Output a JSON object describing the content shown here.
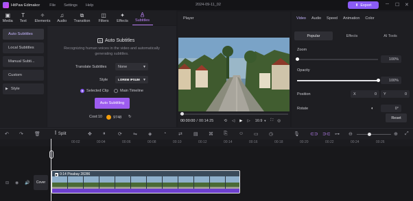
{
  "app": {
    "name": "HitPaw Edimakor",
    "menu": [
      "File",
      "Settings",
      "Help"
    ],
    "date": "2024-09-11_02",
    "export_label": "Export"
  },
  "toolbar": [
    {
      "label": "Media",
      "icon": "media-icon"
    },
    {
      "label": "Text",
      "icon": "text-icon"
    },
    {
      "label": "Elements",
      "icon": "elements-icon"
    },
    {
      "label": "Audio",
      "icon": "audio-icon"
    },
    {
      "label": "Transition",
      "icon": "transition-icon"
    },
    {
      "label": "Filters",
      "icon": "filters-icon"
    },
    {
      "label": "Effects",
      "icon": "effects-icon"
    },
    {
      "label": "Subtitles",
      "icon": "subtitles-icon",
      "active": true
    }
  ],
  "leftnav": [
    "Auto Subtitles",
    "Local Subtitles",
    "Manual Subti...",
    "Custom",
    "Style"
  ],
  "panel": {
    "title": "Auto Subtitles",
    "description": "Recognizing human voices in the video and automatically generating subtitles.",
    "translate_label": "Translate Subtitles",
    "translate_value": "None",
    "style_label": "Style",
    "style_value": "LOREM IPSUM",
    "radio_selected": "Selected Clip",
    "radio_main": "Main Timeline",
    "button": "Auto Subtitling",
    "cost_label": "Cost:10",
    "balance": "9748"
  },
  "player": {
    "title": "Player",
    "current": "00:00:00",
    "total": "00:14:25",
    "ratio": "16:9",
    "progress": 0.0
  },
  "right": {
    "tabs": [
      "Video",
      "Audio",
      "Speed",
      "Animation",
      "Color"
    ],
    "subtabs": [
      "Popular",
      "Effects",
      "AI Tools"
    ],
    "zoom_label": "Zoom",
    "zoom_value": "100%",
    "zoom_level": 0.0,
    "opacity_label": "Opacity",
    "opacity_value": "100%",
    "opacity_level": 1.0,
    "position_label": "Position",
    "pos_x_label": "X",
    "pos_x": "0",
    "pos_y_label": "Y",
    "pos_y": "0",
    "rotate_label": "Rotate",
    "rotate_value": "0°",
    "reset": "Reset"
  },
  "timeline": {
    "split_label": "Split",
    "ticks": [
      "00:00",
      "00:02",
      "00:04",
      "00:06",
      "00:08",
      "00:10",
      "00:12",
      "00:14",
      "00:16",
      "00:18",
      "00:20",
      "00:22",
      "00:24",
      "00:26"
    ],
    "cover_label": "Cover",
    "clip_label": "0:14 Pixabay 28286"
  },
  "colors": {
    "accent": "#8b5cf6",
    "accent_light": "#c084fc"
  }
}
